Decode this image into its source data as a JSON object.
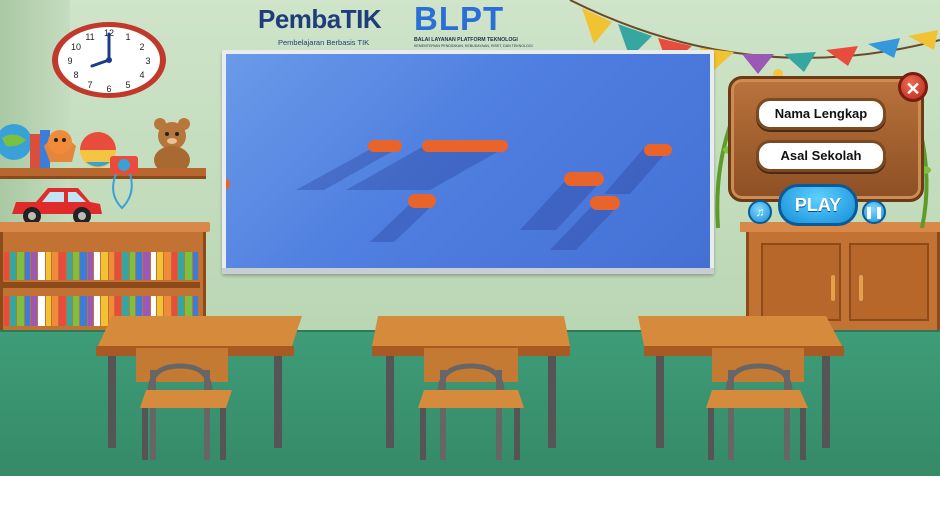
{
  "branding": {
    "pembatik_logo": "PembaTIK",
    "pembatik_tagline": "Pembelajaran Berbasis TIK",
    "blpt_logo": "BLPT",
    "blpt_name": "BALAI LAYANAN PLATFORM TEKNOLOGI",
    "blpt_ministry": "KEMENTERIAN PENDIDIKAN, KEBUDAYAAN, RISET, DAN TEKNOLOGI"
  },
  "menu": {
    "name_button": "Nama Lengkap",
    "school_button": "Asal Sekolah",
    "play_button": "PLAY",
    "close_icon": "close-icon",
    "music_icon": "music-icon",
    "pause_icon": "pause-icon"
  },
  "clock": {
    "time": "4:00"
  },
  "colors": {
    "wall": "#bcd8b8",
    "floor": "#3f9c78",
    "board": "#4f7fe0",
    "wood": "#c27334",
    "play": "#168ed8"
  }
}
